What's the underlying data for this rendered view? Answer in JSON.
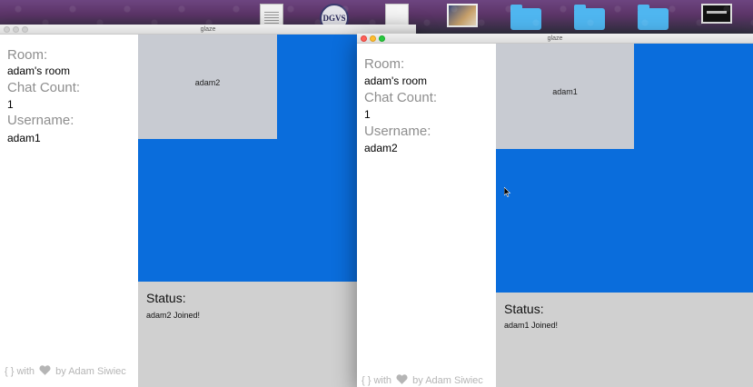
{
  "desktop": {
    "icons": [
      "document-icon",
      "seal-icon",
      "document-icon",
      "photo-icon",
      "folder-icon",
      "folder-icon",
      "folder-icon",
      "screenshot-icon"
    ],
    "seal_text": "DGVS"
  },
  "windows": [
    {
      "title": "glaze",
      "state": "inactive",
      "sidebar": {
        "room_label": "Room:",
        "room_value": "adam's room",
        "chat_count_label": "Chat Count:",
        "chat_count_value": "1",
        "username_label": "Username:",
        "username_value": "adam1",
        "footer_prefix": "{ } with",
        "footer_suffix": "by Adam Siwiec"
      },
      "video_tile_name": "adam2",
      "status": {
        "label": "Status:",
        "message": "adam2 Joined!"
      }
    },
    {
      "title": "glaze",
      "state": "active",
      "sidebar": {
        "room_label": "Room:",
        "room_value": "adam's room",
        "chat_count_label": "Chat Count:",
        "chat_count_value": "1",
        "username_label": "Username:",
        "username_value": "adam2",
        "footer_prefix": "{ } with",
        "footer_suffix": "by Adam Siwiec"
      },
      "video_tile_name": "adam1",
      "status": {
        "label": "Status:",
        "message": "adam1 Joined!"
      }
    }
  ],
  "colors": {
    "main_blue": "#0a6ddc",
    "video_tile_gray": "#c8cbd2",
    "status_panel_gray": "#d0d0d0",
    "label_gray": "#8e8e8e",
    "footer_gray": "#b5b5b5"
  }
}
